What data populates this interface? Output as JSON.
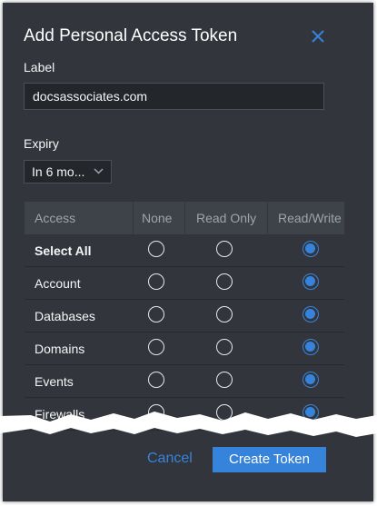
{
  "dialog": {
    "title": "Add Personal Access Token",
    "close_icon": "close-icon"
  },
  "label_field": {
    "label": "Label",
    "value": "docsassociates.com"
  },
  "expiry": {
    "label": "Expiry",
    "selected": "In 6 mo...",
    "icon": "chevron-down-icon"
  },
  "table": {
    "headers": [
      "Access",
      "None",
      "Read Only",
      "Read/Write"
    ],
    "rows": [
      {
        "label": "Select All",
        "selected": "Read/Write"
      },
      {
        "label": "Account",
        "selected": "Read/Write"
      },
      {
        "label": "Databases",
        "selected": "Read/Write"
      },
      {
        "label": "Domains",
        "selected": "Read/Write"
      },
      {
        "label": "Events",
        "selected": "Read/Write"
      },
      {
        "label": "Firewalls",
        "selected": "Read/Write"
      }
    ]
  },
  "actions": {
    "cancel": "Cancel",
    "create": "Create Token"
  },
  "colors": {
    "background": "#32363c",
    "accent": "#3683dc",
    "table_header": "#3e4349"
  }
}
